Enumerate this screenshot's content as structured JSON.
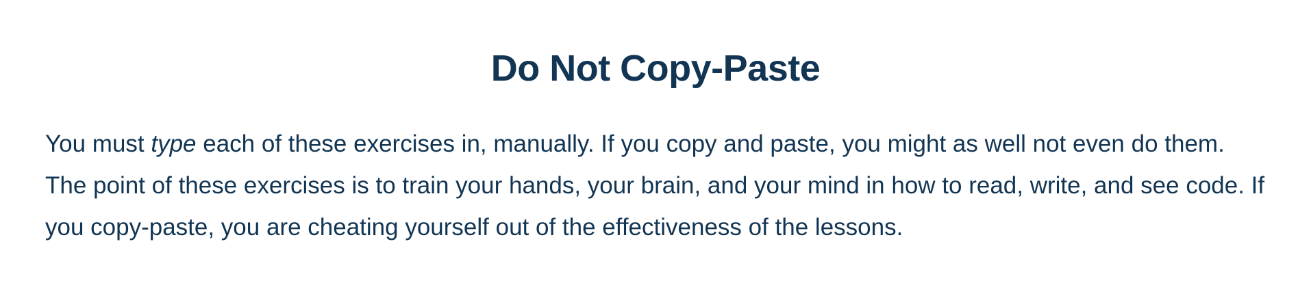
{
  "section": {
    "title": "Do Not Copy-Paste",
    "paragraph": {
      "part1": "You must ",
      "emphasis": "type",
      "part2": " each of these exercises in, manually. If you copy and paste, you might as well not even do them. The point of these exercises is to train your hands, your brain, and your mind in how to read, write, and see code. If you copy-paste, you are cheating yourself out of the effectiveness of the lessons."
    }
  },
  "colors": {
    "text": "#123553",
    "background": "#ffffff"
  }
}
